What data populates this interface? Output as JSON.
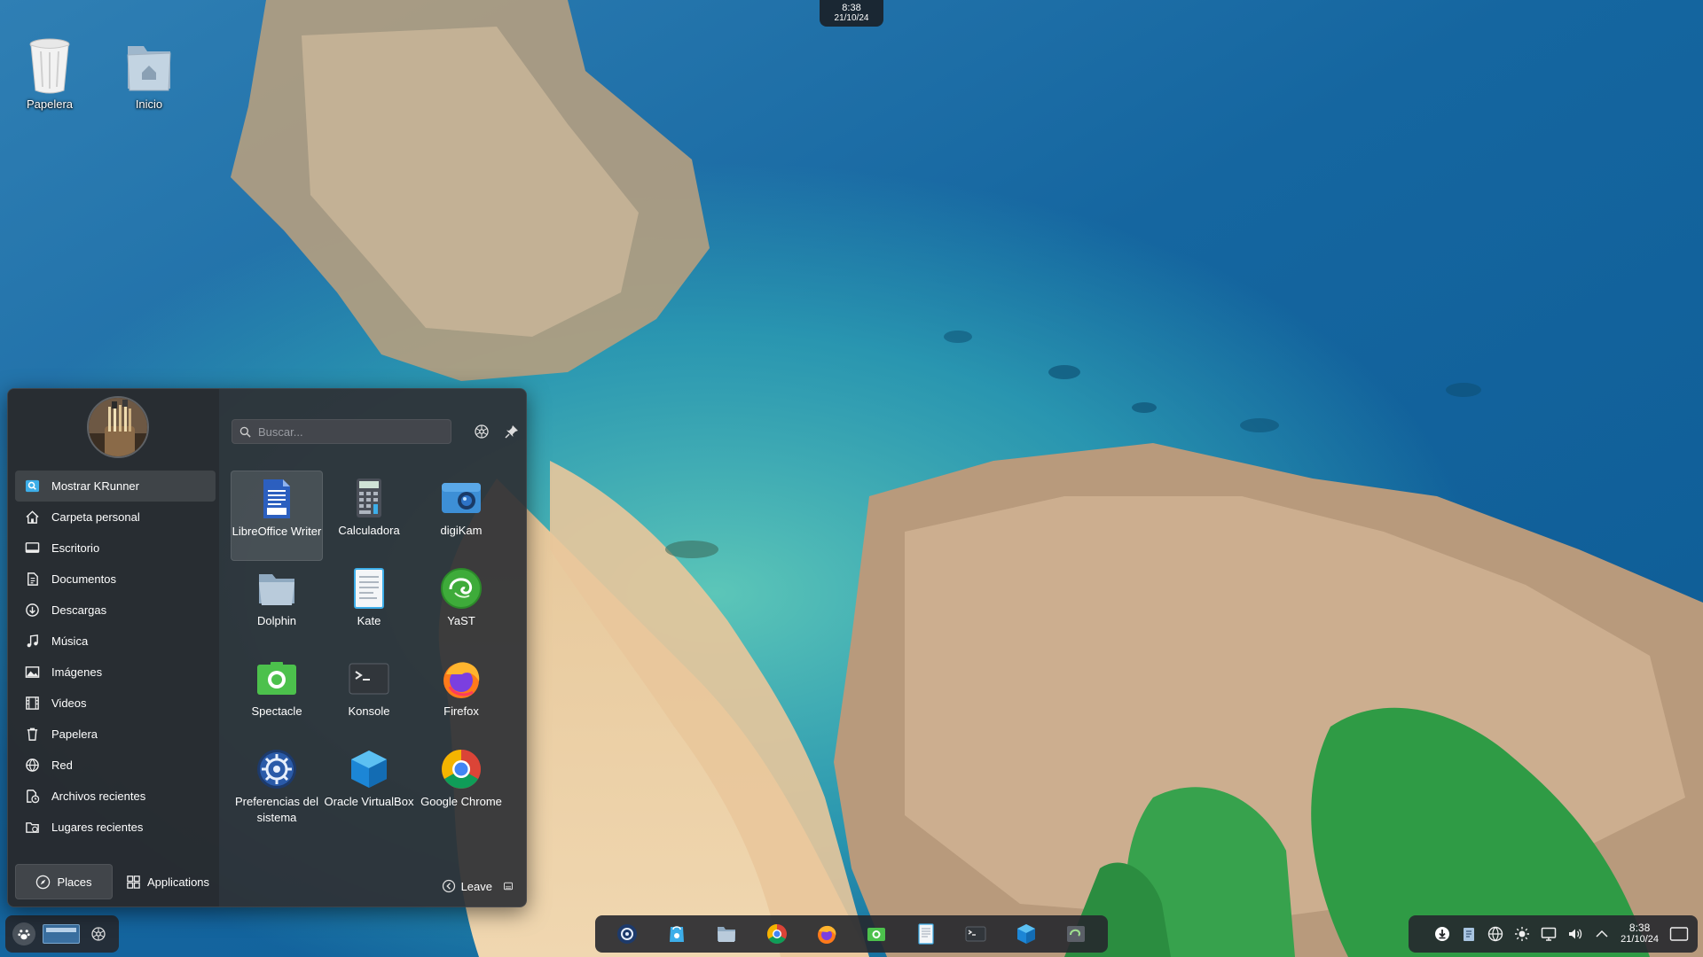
{
  "desktop": {
    "icons": [
      {
        "label": "Papelera",
        "icon": "trash-icon"
      },
      {
        "label": "Inicio",
        "icon": "home-folder-icon"
      }
    ]
  },
  "top_clock": {
    "time": "8:38",
    "date": "21/10/24"
  },
  "launcher": {
    "search": {
      "placeholder": "Buscar..."
    },
    "places": [
      {
        "label": "Mostrar KRunner",
        "icon": "krunner-icon"
      },
      {
        "label": "Carpeta personal",
        "icon": "home-icon"
      },
      {
        "label": "Escritorio",
        "icon": "desktop-icon"
      },
      {
        "label": "Documentos",
        "icon": "documents-icon"
      },
      {
        "label": "Descargas",
        "icon": "downloads-icon"
      },
      {
        "label": "Música",
        "icon": "music-icon"
      },
      {
        "label": "Imágenes",
        "icon": "pictures-icon"
      },
      {
        "label": "Videos",
        "icon": "videos-icon"
      },
      {
        "label": "Papelera",
        "icon": "trash-icon"
      },
      {
        "label": "Red",
        "icon": "network-icon"
      },
      {
        "label": "Archivos recientes",
        "icon": "recent-files-icon"
      },
      {
        "label": "Lugares recientes",
        "icon": "recent-places-icon"
      }
    ],
    "apps": [
      {
        "label": "LibreOffice Writer",
        "icon": "libreoffice-writer-icon"
      },
      {
        "label": "Calculadora",
        "icon": "calculator-icon"
      },
      {
        "label": "digiKam",
        "icon": "digikam-icon"
      },
      {
        "label": "Dolphin",
        "icon": "dolphin-icon"
      },
      {
        "label": "Kate",
        "icon": "kate-icon"
      },
      {
        "label": "YaST",
        "icon": "yast-icon"
      },
      {
        "label": "Spectacle",
        "icon": "spectacle-icon"
      },
      {
        "label": "Konsole",
        "icon": "konsole-icon"
      },
      {
        "label": "Firefox",
        "icon": "firefox-icon"
      },
      {
        "label": "Preferencias del sistema",
        "icon": "system-settings-icon"
      },
      {
        "label": "Oracle VirtualBox",
        "icon": "virtualbox-icon"
      },
      {
        "label": "Google Chrome",
        "icon": "chrome-icon"
      }
    ],
    "tabs": {
      "places": "Places",
      "applications": "Applications"
    },
    "leave": "Leave"
  },
  "taskbar": {
    "tasks": [
      "system-settings-icon",
      "discover-icon",
      "dolphin-icon",
      "chrome-icon",
      "firefox-icon",
      "spectacle-icon",
      "kate-icon",
      "konsole-icon",
      "virtualbox-icon",
      "yast-icon"
    ]
  },
  "systray": {
    "time": "8:38",
    "date": "21/10/24"
  }
}
